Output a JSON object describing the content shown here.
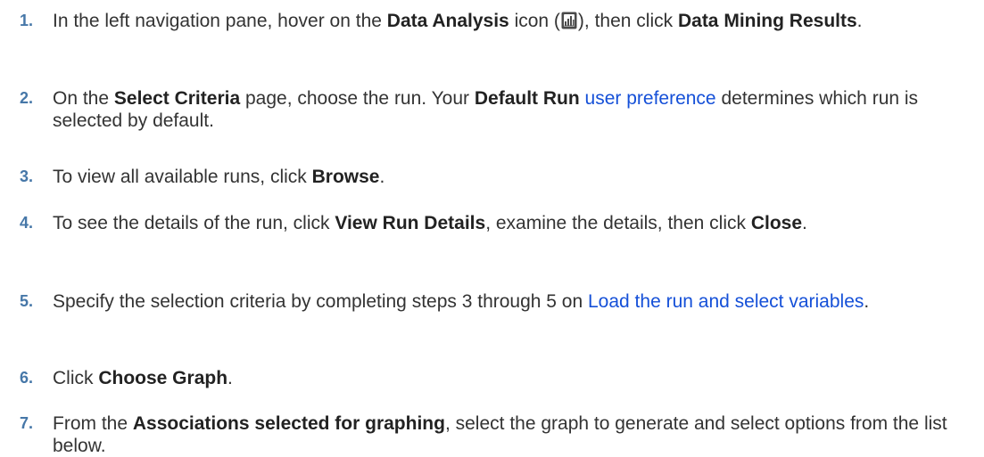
{
  "steps": [
    {
      "number": "1.",
      "t1": "In the left navigation pane, hover on the ",
      "b1": "Data Analysis",
      "t2": " icon (",
      "icon": "data-analysis-icon",
      "t3": "), then click ",
      "b2": "Data Mining Results",
      "t4": "."
    },
    {
      "number": "2.",
      "t1": "On the ",
      "b1": "Select Criteria",
      "t2": " page, choose the run. Your ",
      "b2": "Default Run",
      "t3": " ",
      "link1": "user preference",
      "t4": " determines which run is selected by default."
    },
    {
      "number": "3.",
      "t1": "To view all available runs, click ",
      "b1": "Browse",
      "t2": "."
    },
    {
      "number": "4.",
      "t1": "To see the details of the run, click ",
      "b1": "View Run Details",
      "t2": ", examine the details, then click ",
      "b2": "Close",
      "t3": "."
    },
    {
      "number": "5.",
      "t1": "Specify the selection criteria by completing steps 3 through 5 on ",
      "link1": "Load the run and select variables",
      "t2": "."
    },
    {
      "number": "6.",
      "t1": "Click ",
      "b1": "Choose Graph",
      "t2": "."
    },
    {
      "number": "7.",
      "t1": "From the ",
      "b1": "Associations selected for graphing",
      "t2": ", select the graph to generate and select options from the list below."
    }
  ],
  "colors": {
    "step_number": "#4677a8",
    "link": "#1550d8",
    "text": "#333333"
  }
}
